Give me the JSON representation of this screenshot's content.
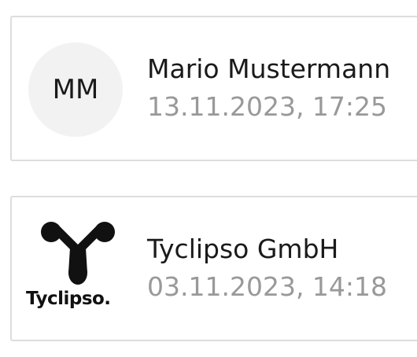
{
  "cards": [
    {
      "avatar_initials": "MM",
      "name": "Mario Mustermann",
      "datetime": "13.11.2023, 17:25"
    },
    {
      "logo_text": "Tyclipso.",
      "logo_icon": "tyclipso-logo-icon",
      "name": "Tyclipso GmbH",
      "datetime": "03.11.2023, 14:18"
    }
  ]
}
